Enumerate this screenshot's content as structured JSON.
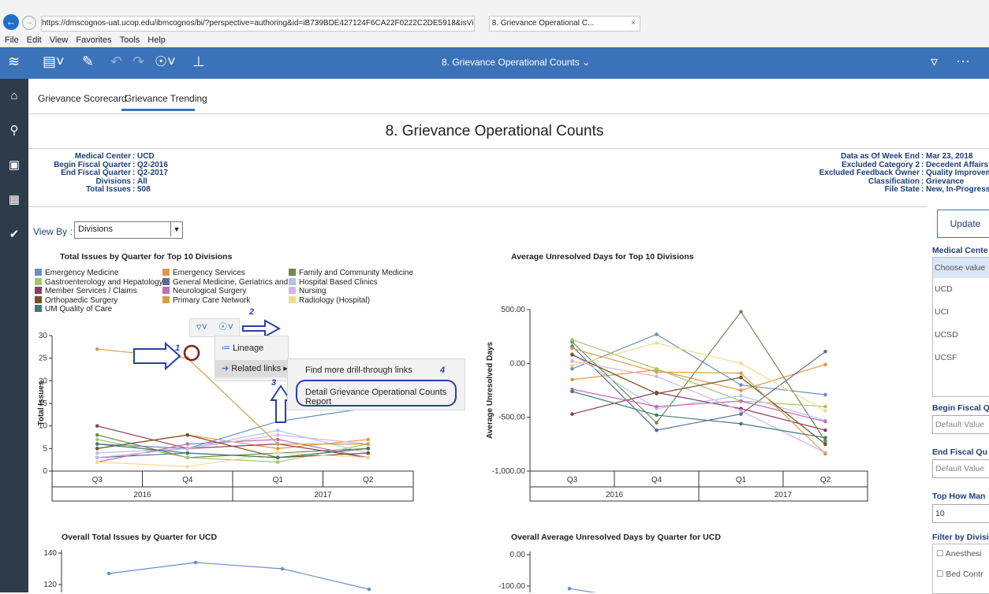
{
  "browser": {
    "url": "https://dmscognos-uat.ucop.edu/ibmcognos/bi/?perspective=authoring&id=iB739BDE427124F6CA22F0222C2DE5918&isViewer=false&isNewFromM",
    "tab_title": "8. Grievance Operational C...",
    "menu": [
      "File",
      "Edit",
      "View",
      "Favorites",
      "Tools",
      "Help"
    ]
  },
  "appbar": {
    "title": "8. Grievance Operational Counts"
  },
  "tabs": [
    "Grievance Scorecard",
    "Grievance Trending"
  ],
  "page_title": "8. Grievance Operational Counts",
  "params_left": [
    [
      "Medical Center",
      "UCD"
    ],
    [
      "Begin Fiscal Quarter",
      "Q2-2016"
    ],
    [
      "End Fiscal Quarter",
      "Q2-2017"
    ],
    [
      "Divisions",
      "All"
    ],
    [
      "Total Issues",
      "508"
    ]
  ],
  "params_right": [
    [
      "Data as Of Week End",
      "Mar 23, 2018"
    ],
    [
      "Excluded Category 2",
      "Decedent Affairs"
    ],
    [
      "Excluded Feedback Owner",
      "Quality Improveme"
    ],
    [
      "Classification",
      "Grievance"
    ],
    [
      "File State",
      "New, In-Progress, C"
    ]
  ],
  "viewby": {
    "label": "View By :",
    "value": "Divisions"
  },
  "legend": [
    {
      "name": "Emergency Medicine",
      "color": "#6a8fc8"
    },
    {
      "name": "Emergency Services",
      "color": "#e8934a"
    },
    {
      "name": "Family and Community Medicine",
      "color": "#6b8a4e"
    },
    {
      "name": "Gastroenterology and Hepatology",
      "color": "#a6c46a"
    },
    {
      "name": "General Medicine, Geriatrics and ...",
      "color": "#5f6b94"
    },
    {
      "name": "Hospital Based Clinics",
      "color": "#aec3ea"
    },
    {
      "name": "Member Services / Claims",
      "color": "#8a3d5e"
    },
    {
      "name": "Neurological Surgery",
      "color": "#c06cb8"
    },
    {
      "name": "Nursing",
      "color": "#d4b4e4"
    },
    {
      "name": "Orthopaedic Surgery",
      "color": "#7a4f22"
    },
    {
      "name": "Primary Care Network",
      "color": "#d4a04a"
    },
    {
      "name": "Radiology (Hospital)",
      "color": "#f0dc8c"
    },
    {
      "name": "UM Quality of Care",
      "color": "#3f7a78"
    }
  ],
  "chart_data": [
    {
      "type": "line",
      "title": "Total Issues by Quarter for Top  10 Divisions",
      "ylabel": "Total Issues",
      "ylim": [
        0,
        30
      ],
      "yticks": [
        "0",
        "5",
        "10",
        "15",
        "20",
        "25",
        "30"
      ],
      "x": [
        "Q3",
        "Q4",
        "Q1",
        "Q2"
      ],
      "years": [
        "2016",
        "2017"
      ],
      "series": [
        {
          "name": "Emergency Medicine",
          "values": [
            6,
            5,
            11,
            14
          ]
        },
        {
          "name": "Emergency Services",
          "values": [
            5,
            8,
            5,
            7
          ]
        },
        {
          "name": "Family and Community Medicine",
          "values": [
            8,
            3,
            4,
            5
          ]
        },
        {
          "name": "Gastroenterology and Hepatology",
          "values": [
            7,
            3,
            2,
            6
          ]
        },
        {
          "name": "General Medicine, Geriatrics and ...",
          "values": [
            3,
            4,
            3,
            5
          ]
        },
        {
          "name": "Hospital Based Clinics",
          "values": [
            4,
            5,
            9,
            4
          ]
        },
        {
          "name": "Member Services / Claims",
          "values": [
            10,
            5,
            6,
            3
          ]
        },
        {
          "name": "Neurological Surgery",
          "values": [
            2,
            6,
            7,
            3
          ]
        },
        {
          "name": "Nursing",
          "values": [
            3,
            5,
            8,
            6
          ]
        },
        {
          "name": "Orthopaedic Surgery",
          "values": [
            5,
            8,
            3,
            4
          ]
        },
        {
          "name": "Primary Care Network",
          "values": [
            27,
            25,
            6,
            6
          ]
        },
        {
          "name": "Radiology (Hospital)",
          "values": [
            2,
            1,
            4,
            3
          ]
        },
        {
          "name": "UM Quality of Care",
          "values": [
            6,
            4,
            3,
            5
          ]
        }
      ]
    },
    {
      "type": "line",
      "title": "Average Unresolved Days for Top  10 Divisions",
      "ylabel": "Average Unresolved Days",
      "ylim": [
        -1000,
        500
      ],
      "yticks": [
        "-1,000.00",
        "-500.00",
        "0.00",
        "500.00"
      ],
      "x": [
        "Q3",
        "Q4",
        "Q1",
        "Q2"
      ],
      "years": [
        "2016",
        "2017"
      ],
      "series": [
        {
          "name": "Emergency Medicine",
          "values": [
            -50,
            270,
            -200,
            -290
          ]
        },
        {
          "name": "Emergency Services",
          "values": [
            -150,
            -60,
            -250,
            -10
          ]
        },
        {
          "name": "Family and Community Medicine",
          "values": [
            200,
            -550,
            480,
            -720
          ]
        },
        {
          "name": "Gastroenterology and Hepatology",
          "values": [
            220,
            -50,
            -350,
            -400
          ]
        },
        {
          "name": "General Medicine, Geriatrics and ...",
          "values": [
            160,
            -620,
            -470,
            110
          ]
        },
        {
          "name": "Hospital Based Clinics",
          "values": [
            90,
            -420,
            -300,
            -530
          ]
        },
        {
          "name": "Member Services / Claims",
          "values": [
            -470,
            -270,
            -420,
            -620
          ]
        },
        {
          "name": "Neurological Surgery",
          "values": [
            -240,
            -400,
            -350,
            -540
          ]
        },
        {
          "name": "Nursing",
          "values": [
            20,
            -120,
            -440,
            -830
          ]
        },
        {
          "name": "Orthopaedic Surgery",
          "values": [
            80,
            -280,
            -130,
            -750
          ]
        },
        {
          "name": "Primary Care Network",
          "values": [
            140,
            -80,
            -90,
            -840
          ]
        },
        {
          "name": "Radiology (Hospital)",
          "values": [
            -20,
            190,
            0,
            -440
          ]
        },
        {
          "name": "UM Quality of Care",
          "values": [
            -260,
            -480,
            -560,
            -690
          ]
        }
      ]
    },
    {
      "type": "line",
      "title": "Overall Total Issues by Quarter for UCD",
      "yticks": [
        "120",
        "140"
      ],
      "series": [
        {
          "values": [
            127,
            134,
            130,
            117
          ]
        }
      ]
    },
    {
      "type": "line",
      "title": "Overall Average Unresolved Days by Quarter for UCD",
      "yticks": [
        "-100.00",
        "0.00"
      ],
      "series": [
        {
          "values": [
            -108
          ]
        }
      ]
    }
  ],
  "popup": {
    "lineage": "Lineage",
    "related_links": "Related links",
    "find_more": "Find more drill-through links",
    "detail_report": "Detail Grievance Operational Counts Report"
  },
  "annotations": [
    "1",
    "2",
    "3",
    "4"
  ],
  "right_panel": {
    "update": "Update",
    "medical_center_label": "Medical Cente",
    "medical_center_choose": "Choose value",
    "medical_center_options": [
      "UCD",
      "UCI",
      "UCSD",
      "UCSF"
    ],
    "begin_label": "Begin Fiscal Q",
    "begin_value": "Default Value",
    "end_label": "End Fiscal Qu",
    "end_value": "Default Value",
    "top_label": "Top How Man",
    "top_value": "10",
    "filter_label": "Filter by Divisi",
    "filter_options": [
      "Anesthesi",
      "Bed Contr"
    ]
  }
}
